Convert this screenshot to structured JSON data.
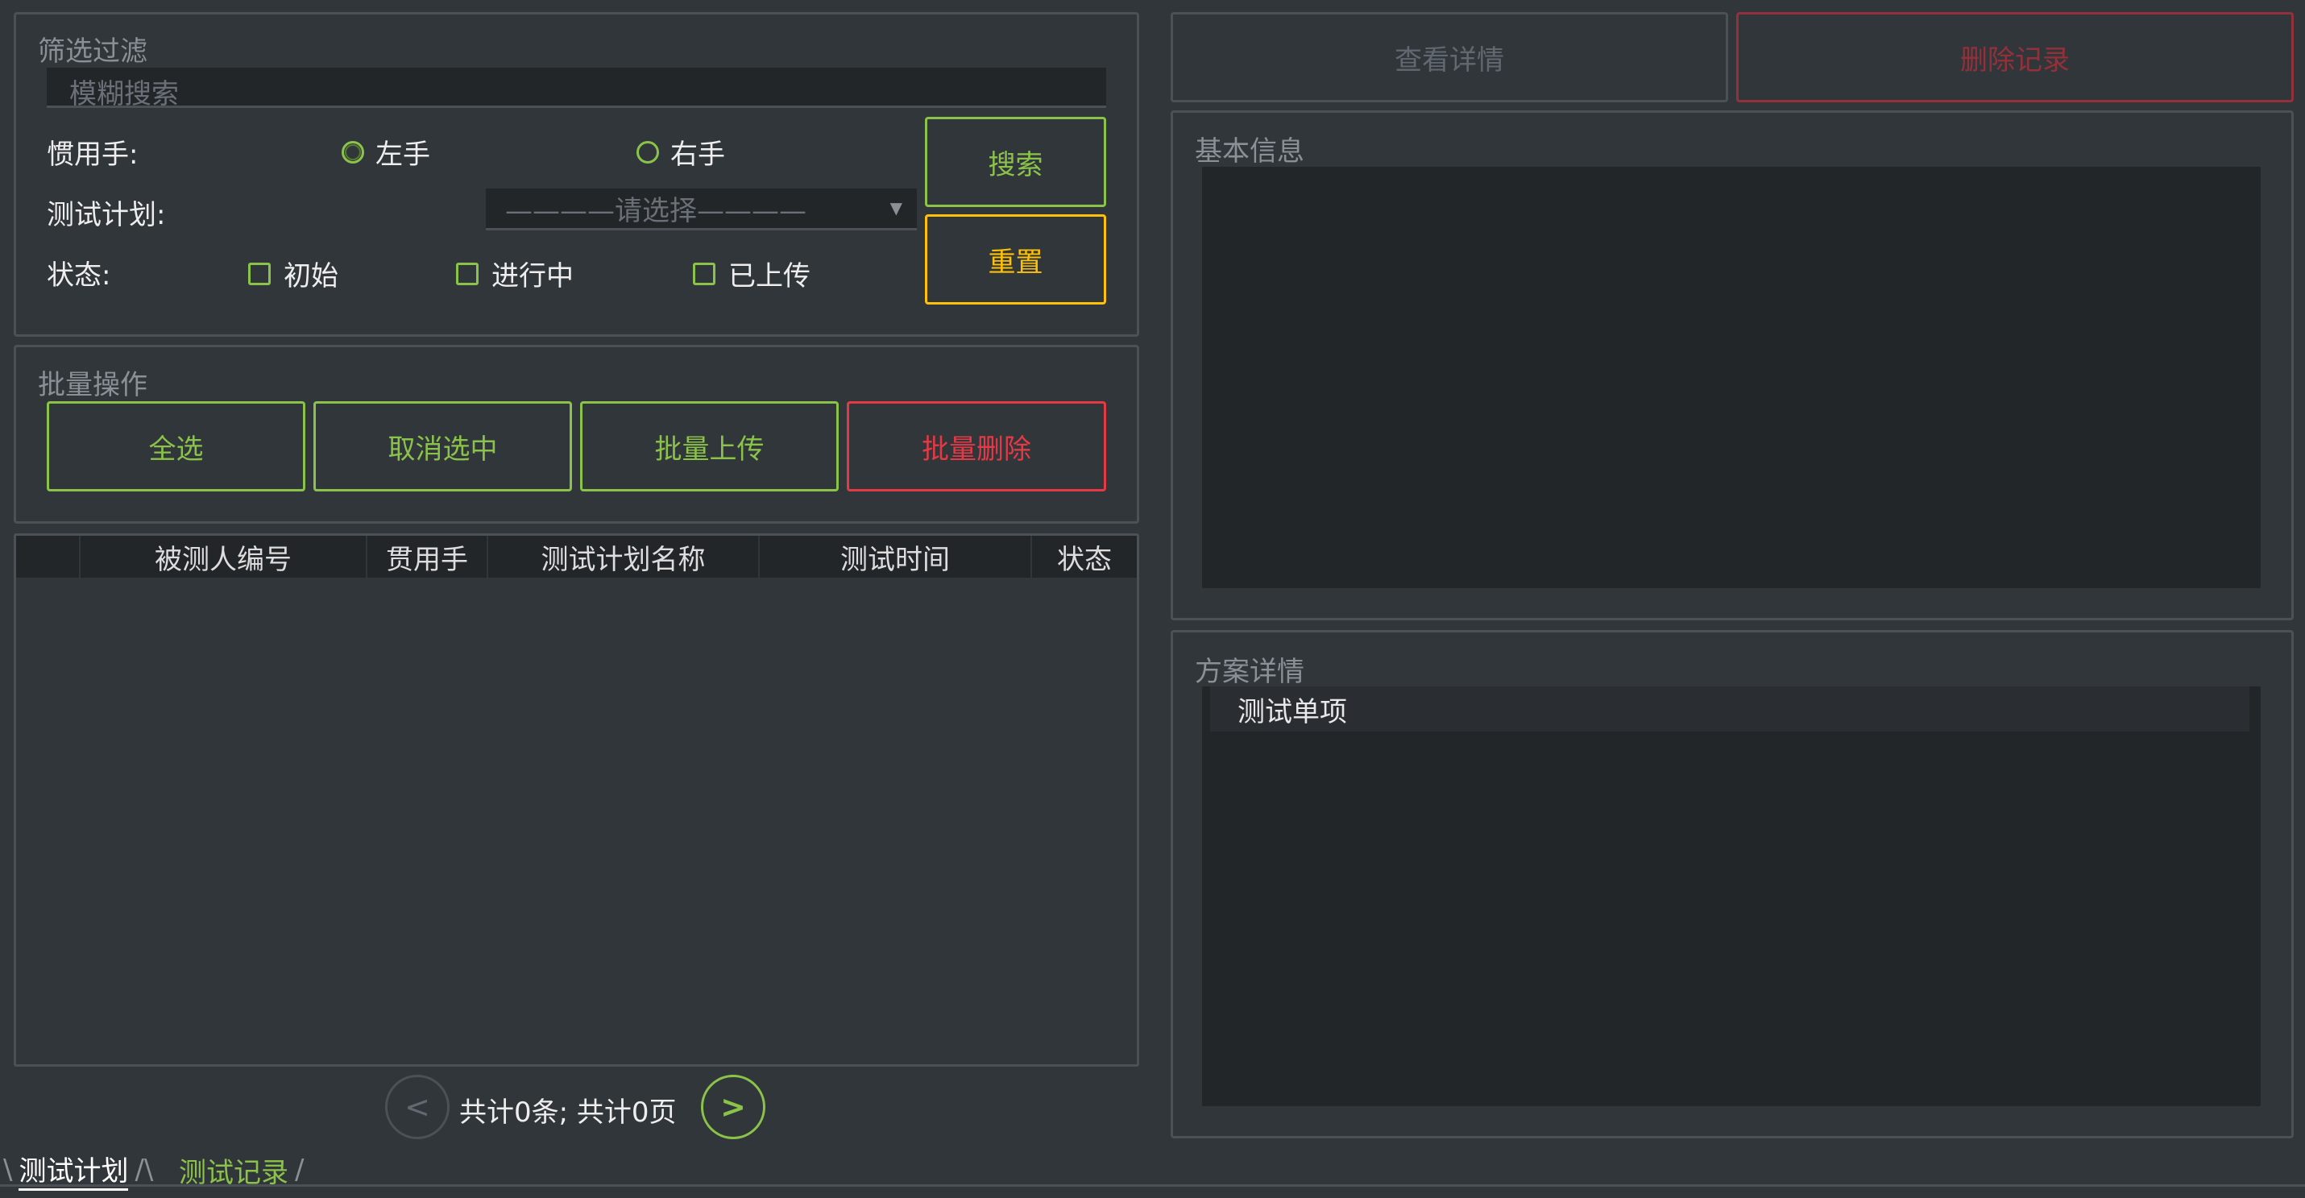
{
  "filter": {
    "title": "筛选过滤",
    "search_placeholder": "模糊搜索",
    "hand_label": "惯用手:",
    "hand_options": [
      "左手",
      "右手"
    ],
    "plan_label": "测试计划:",
    "plan_select": "————请选择————",
    "status_label": "状态:",
    "status_options": [
      "初始",
      "进行中",
      "已上传"
    ],
    "search_button": "搜索",
    "reset_button": "重置"
  },
  "batch": {
    "title": "批量操作",
    "select_all": "全选",
    "deselect": "取消选中",
    "batch_upload": "批量上传",
    "batch_delete": "批量删除"
  },
  "table": {
    "columns": [
      "被测人编号",
      "贯用手",
      "测试计划名称",
      "测试时间",
      "状态"
    ],
    "rows": []
  },
  "pagination": {
    "prev": "<",
    "next": ">",
    "summary": "共计0条; 共计0页"
  },
  "actions": {
    "view_details": "查看详情",
    "delete_record": "删除记录"
  },
  "basic_info": {
    "title": "基本信息"
  },
  "plan_details": {
    "title": "方案详情",
    "header": "测试单项"
  },
  "tabs": [
    {
      "label": "测试计划",
      "active": true
    },
    {
      "label": "测试记录",
      "active": false
    }
  ],
  "colors": {
    "background": "#31363b",
    "accent_green": "#8bc34a",
    "accent_yellow": "#ffc107",
    "danger_red": "#e53945"
  }
}
